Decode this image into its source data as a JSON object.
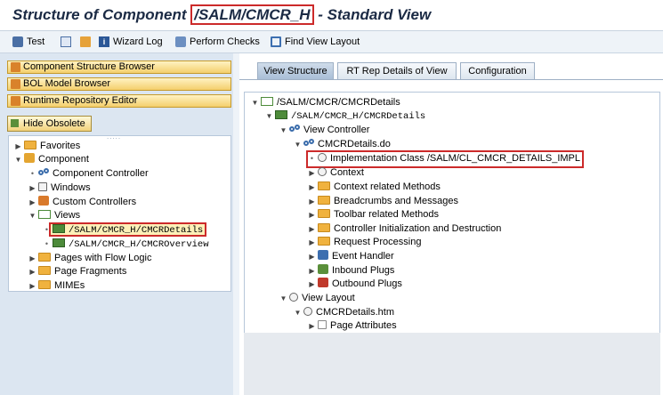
{
  "window": {
    "title_before": "Structure of Component ",
    "title_component": "/SALM/CMCR_H",
    "title_after": " - Standard View"
  },
  "toolbar": {
    "test": "Test",
    "wizard_log": "Wizard Log",
    "perform_checks": "Perform Checks",
    "find_view_layout": "Find View Layout"
  },
  "left_panel": {
    "component_structure_browser": "Component Structure Browser",
    "bol_model_browser": "BOL Model Browser",
    "runtime_repository_editor": "Runtime Repository Editor",
    "hide_obsolete": "Hide Obsolete",
    "tree": {
      "favorites": "Favorites",
      "component": "Component",
      "component_controller": "Component Controller",
      "windows": "Windows",
      "custom_controllers": "Custom Controllers",
      "views": "Views",
      "view_details": "/SALM/CMCR_H/CMCRDetails",
      "view_overview": "/SALM/CMCR_H/CMCROverview",
      "pages_with_flow_logic": "Pages with Flow Logic",
      "page_fragments": "Page Fragments",
      "mimes": "MIMEs"
    }
  },
  "tabs": {
    "view_structure": "View Structure",
    "rt_rep_details": "RT Rep Details of View",
    "configuration": "Configuration"
  },
  "structure_tree": {
    "root": "/SALM/CMCR/CMCRDetails",
    "view": "/SALM/CMCR_H/CMCRDetails",
    "view_controller": "View Controller",
    "controller_file": "CMCRDetails.do",
    "impl_class": "Implementation Class /SALM/CL_CMCR_DETAILS_IMPL",
    "context": "Context",
    "context_methods": "Context related Methods",
    "breadcrumbs": "Breadcrumbs and Messages",
    "toolbar_methods": "Toolbar related Methods",
    "controller_init": "Controller Initialization and Destruction",
    "request_processing": "Request Processing",
    "event_handler": "Event Handler",
    "inbound_plugs": "Inbound Plugs",
    "outbound_plugs": "Outbound Plugs",
    "view_layout": "View Layout",
    "layout_file": "CMCRDetails.htm",
    "page_attributes": "Page Attributes"
  }
}
